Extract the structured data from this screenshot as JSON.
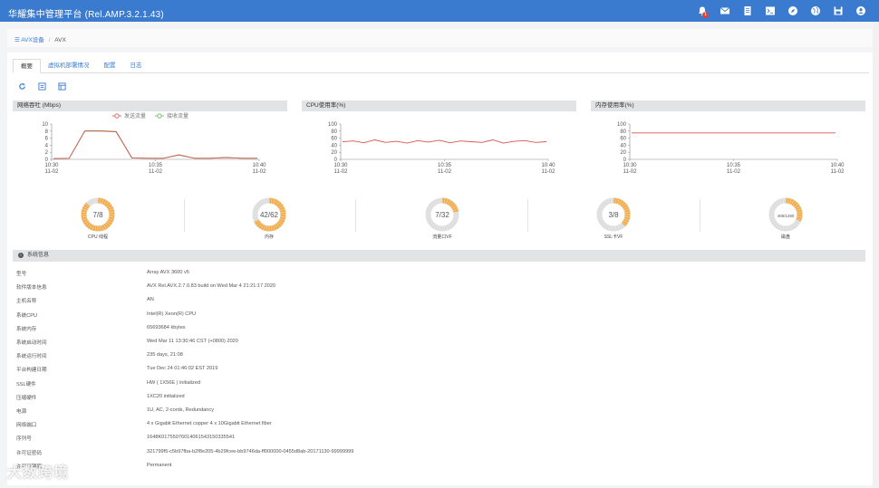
{
  "app": {
    "title": "华耀集中管理平台 (Rel.AMP.3.2.1.43)",
    "notification_count": "1"
  },
  "topbar_icons": [
    "bell-icon",
    "mail-icon",
    "document-icon",
    "terminal-icon",
    "compass-icon",
    "globe-icon",
    "save-icon",
    "user-icon"
  ],
  "breadcrumb": {
    "root": "AVX设备",
    "current": "AVX"
  },
  "tabs": [
    "概要",
    "虚拟机部署情况",
    "配置",
    "日志"
  ],
  "toolbar_icons": [
    "refresh-icon",
    "export-icon",
    "report-icon"
  ],
  "colors": {
    "accent": "#3a7bd0",
    "send": "#d9534f",
    "recv": "#5cb85c",
    "gauge": "#f0ad4e",
    "gauge_bg": "#dcdcdc"
  },
  "charts": {
    "throughput": {
      "title": "网络吞吐 (Mbps)",
      "legend": [
        "发送流量",
        "接收流量"
      ],
      "yticks": [
        "10",
        "8",
        "6",
        "4",
        "2",
        "0"
      ],
      "xticks": [
        [
          "10:30",
          "11-02"
        ],
        [
          "10:35",
          "11-02"
        ],
        [
          "10:40",
          "11-02"
        ]
      ]
    },
    "cpu": {
      "title": "CPU使用率(%)",
      "yticks": [
        "100",
        "80",
        "60",
        "40",
        "20",
        "0"
      ],
      "xticks": [
        [
          "10:30",
          "11-02"
        ],
        [
          "10:35",
          "11-02"
        ],
        [
          "10:40",
          "11-02"
        ]
      ]
    },
    "memory": {
      "title": "内存使用率(%)",
      "yticks": [
        "100",
        "80",
        "60",
        "40",
        "20",
        "0"
      ],
      "xticks": [
        [
          "10:30",
          "11-02"
        ],
        [
          "10:35",
          "11-02"
        ],
        [
          "10:40",
          "11-02"
        ]
      ]
    }
  },
  "chart_data": [
    {
      "type": "line",
      "title": "网络吞吐 (Mbps)",
      "ylim": [
        0,
        10
      ],
      "x": [
        "10:30",
        "10:35",
        "10:40"
      ],
      "series": [
        {
          "name": "发送流量",
          "values": [
            0.2,
            0.3,
            8.0,
            8.0,
            7.8,
            0.4,
            0.3,
            0.3,
            1.3,
            0.3,
            0.3,
            0.5,
            0.3,
            0.3
          ]
        },
        {
          "name": "接收流量",
          "values": [
            0.2,
            0.3,
            8.1,
            8.1,
            7.9,
            0.4,
            0.3,
            0.3,
            1.2,
            0.3,
            0.3,
            0.5,
            0.3,
            0.3
          ]
        }
      ]
    },
    {
      "type": "line",
      "title": "CPU使用率(%)",
      "ylim": [
        0,
        100
      ],
      "x": [
        "10:30",
        "10:35",
        "10:40"
      ],
      "series": [
        {
          "values": [
            50,
            52,
            47,
            55,
            48,
            51,
            46,
            53,
            49,
            54,
            47,
            52,
            50,
            48,
            55,
            46,
            51,
            53,
            48,
            50
          ]
        }
      ]
    },
    {
      "type": "line",
      "title": "内存使用率(%)",
      "ylim": [
        0,
        100
      ],
      "x": [
        "10:30",
        "10:35",
        "10:40"
      ],
      "series": [
        {
          "values": [
            75,
            75,
            75,
            75,
            75
          ]
        }
      ]
    }
  ],
  "gauges": [
    {
      "value": "7/8",
      "label": "CPU 线程",
      "fraction": 0.875
    },
    {
      "value": "42/62",
      "label": "内存",
      "fraction": 0.677
    },
    {
      "value": "7/32",
      "label": "流量口VF",
      "fraction": 0.219
    },
    {
      "value": "3/8",
      "label": "SSL卡VF",
      "fraction": 0.375
    },
    {
      "value": "408/1280",
      "label": "磁盘",
      "fraction": 0.319
    }
  ],
  "system": {
    "title": "系统信息",
    "rows": [
      {
        "key": "型号",
        "value": "Array AVX 3600 v5"
      },
      {
        "key": "软件版本信息",
        "value": "AVX Rel.AVX.2.7.0.83 build on Wed Mar 4 21:21:17 2020"
      },
      {
        "key": "主机名称",
        "value": "AN"
      },
      {
        "key": "系统CPU",
        "value": "Intel(R) Xeon(R) CPU"
      },
      {
        "key": "系统内存",
        "value": "65693684 kbytes"
      },
      {
        "key": "系统启动时间",
        "value": "Wed Mar 11 13:30:46 CST (+0800) 2020"
      },
      {
        "key": "系统运行时间",
        "value": "235 days, 21:08"
      },
      {
        "key": "平台构建日期",
        "value": "Tue Dec 24 01:46:02 EST 2019"
      },
      {
        "key": "SSL硬件",
        "value": "HW ( 1X56E ) initialized"
      },
      {
        "key": "压缩硬件",
        "value": "1XC20 initialized"
      },
      {
        "key": "电源",
        "value": "1U, AC, 2-cords, Redundancy"
      },
      {
        "key": "网络端口",
        "value": "4 x Gigabit Ethernet copper 4 x 10Gigabit Ethernet fiber"
      },
      {
        "key": "序列号",
        "value": "1648K01755076014061543150335541"
      },
      {
        "key": "许可证密码",
        "value": "321799f5-c5b97fba-b2f8e205-4b29fcee-bb9746da-ff000000-0455d8ab-20171130-99999999"
      },
      {
        "key": "许可证期限",
        "value": "Permanent"
      }
    ]
  },
  "watermark": "大数跨境"
}
